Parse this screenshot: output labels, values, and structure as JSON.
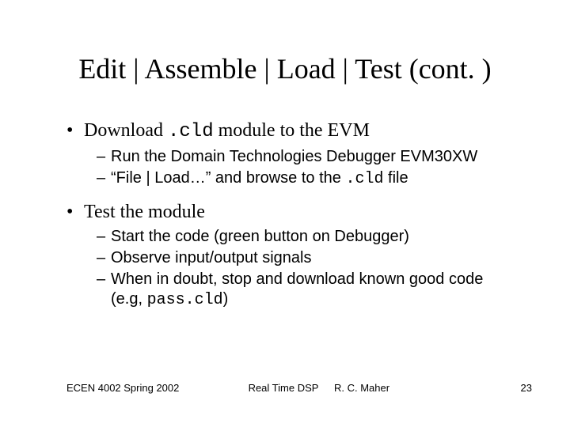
{
  "title": "Edit | Assemble | Load | Test (cont. )",
  "bullets": {
    "b1": {
      "pre": "Download ",
      "code": ".cld",
      "post": " module to the EVM",
      "subs": {
        "s1": "Run the Domain Technologies Debugger EVM30XW",
        "s2_pre": "“File | Load…” and browse to the ",
        "s2_code": ".cld",
        "s2_post": " file"
      }
    },
    "b2": {
      "text": "Test the module",
      "subs": {
        "s1": "Start the code (green button on Debugger)",
        "s2": "Observe input/output signals",
        "s3_pre": "When in doubt, stop and download known good code (e.g, ",
        "s3_code": "pass.cld",
        "s3_post": ")"
      }
    }
  },
  "footer": {
    "left": "ECEN 4002 Spring 2002",
    "center": "Real Time DSP",
    "author": "R. C. Maher",
    "page": "23"
  }
}
